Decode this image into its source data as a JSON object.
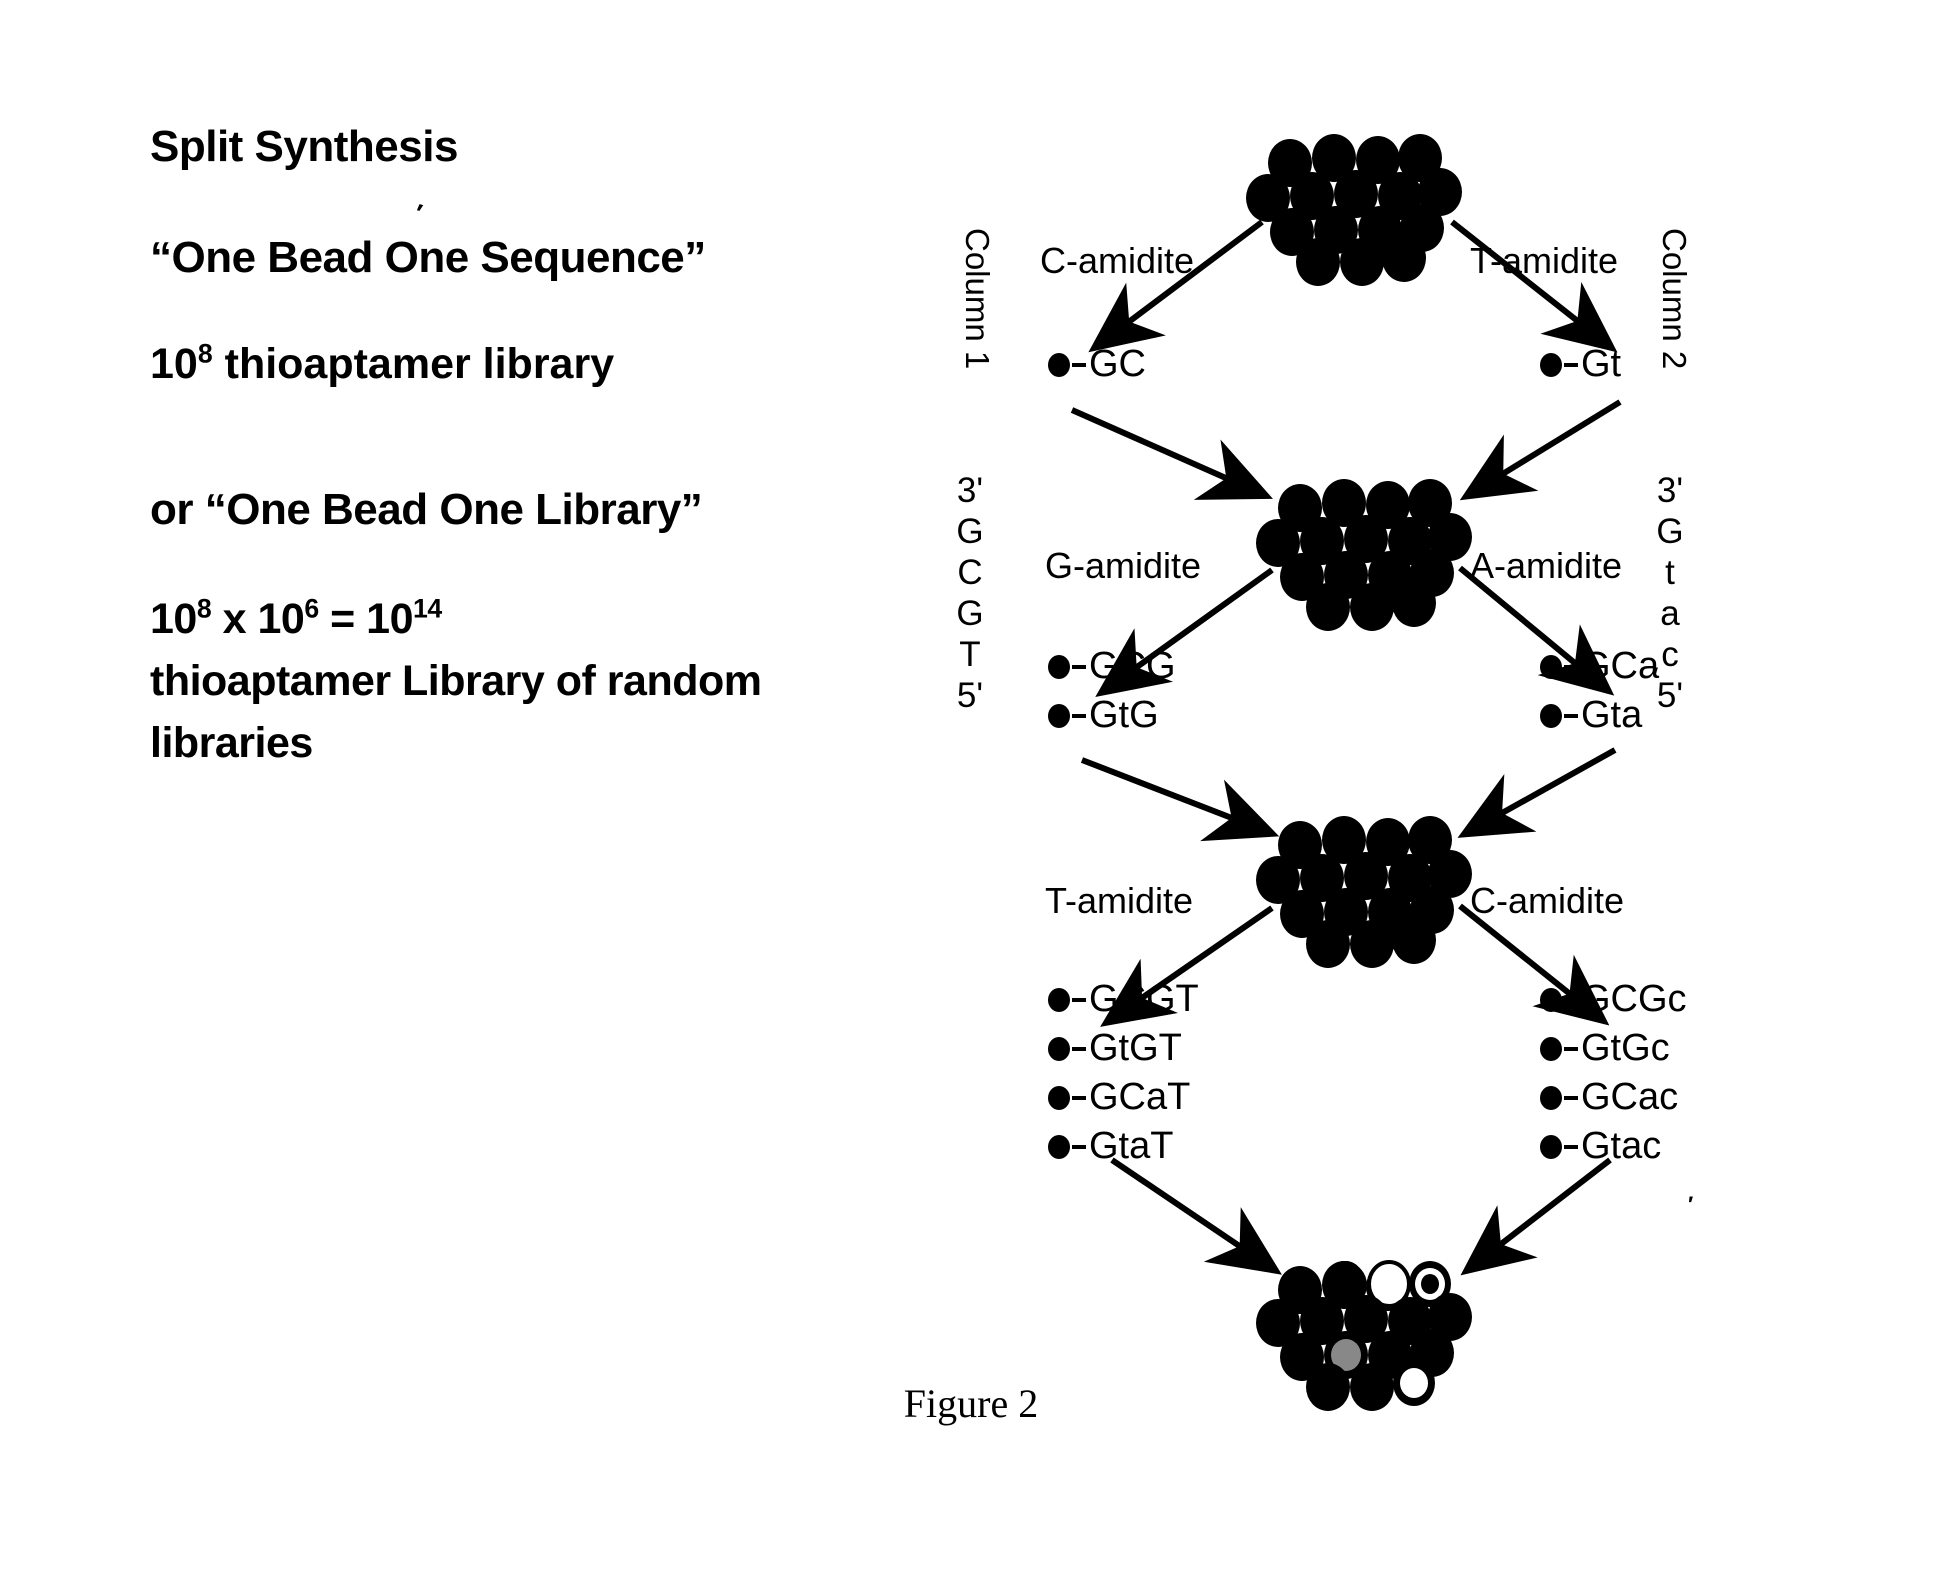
{
  "left_panel": {
    "title": "Split Synthesis",
    "quote_one_bead_one_sequence": "“One Bead One Sequence”",
    "library_line": "10",
    "library_exp": "8",
    "library_rest": " thioaptamer library",
    "quote_one_bead_one_library": "or “One Bead One Library”",
    "formula_a_base": "10",
    "formula_a_exp": "8",
    "formula_mult": " x ",
    "formula_b_base": "10",
    "formula_b_exp": "6",
    "formula_eq": "  =  ",
    "formula_c_base": "10",
    "formula_c_exp": "14",
    "formula_tail": "thioaptamer Library of random libraries",
    "stray_mark": "′"
  },
  "diagram": {
    "column_left_label": "Column 1",
    "column_right_label": "Column 2",
    "sequence_left": "3'\nG\nC\nG\nT\n5'",
    "sequence_right": "3'\nG\nt\na\nc\n5'",
    "levels": [
      {
        "left_amidite": "C-amidite",
        "right_amidite": "T-amidite",
        "left_beads": [
          "GC"
        ],
        "right_beads": [
          "Gt"
        ]
      },
      {
        "left_amidite": "G-amidite",
        "right_amidite": "A-amidite",
        "left_beads": [
          "GCG",
          "GtG"
        ],
        "right_beads": [
          "GCa",
          "Gta"
        ]
      },
      {
        "left_amidite": "T-amidite",
        "right_amidite": "C-amidite",
        "left_beads": [
          "GCGT",
          "GtGT",
          "GCaT",
          "GtaT"
        ],
        "right_beads": [
          "GCGc",
          "GtGc",
          "GCac",
          "Gtac"
        ]
      }
    ]
  },
  "caption": "Figure 2",
  "colors": {
    "ink": "#000000",
    "background": "#ffffff"
  }
}
